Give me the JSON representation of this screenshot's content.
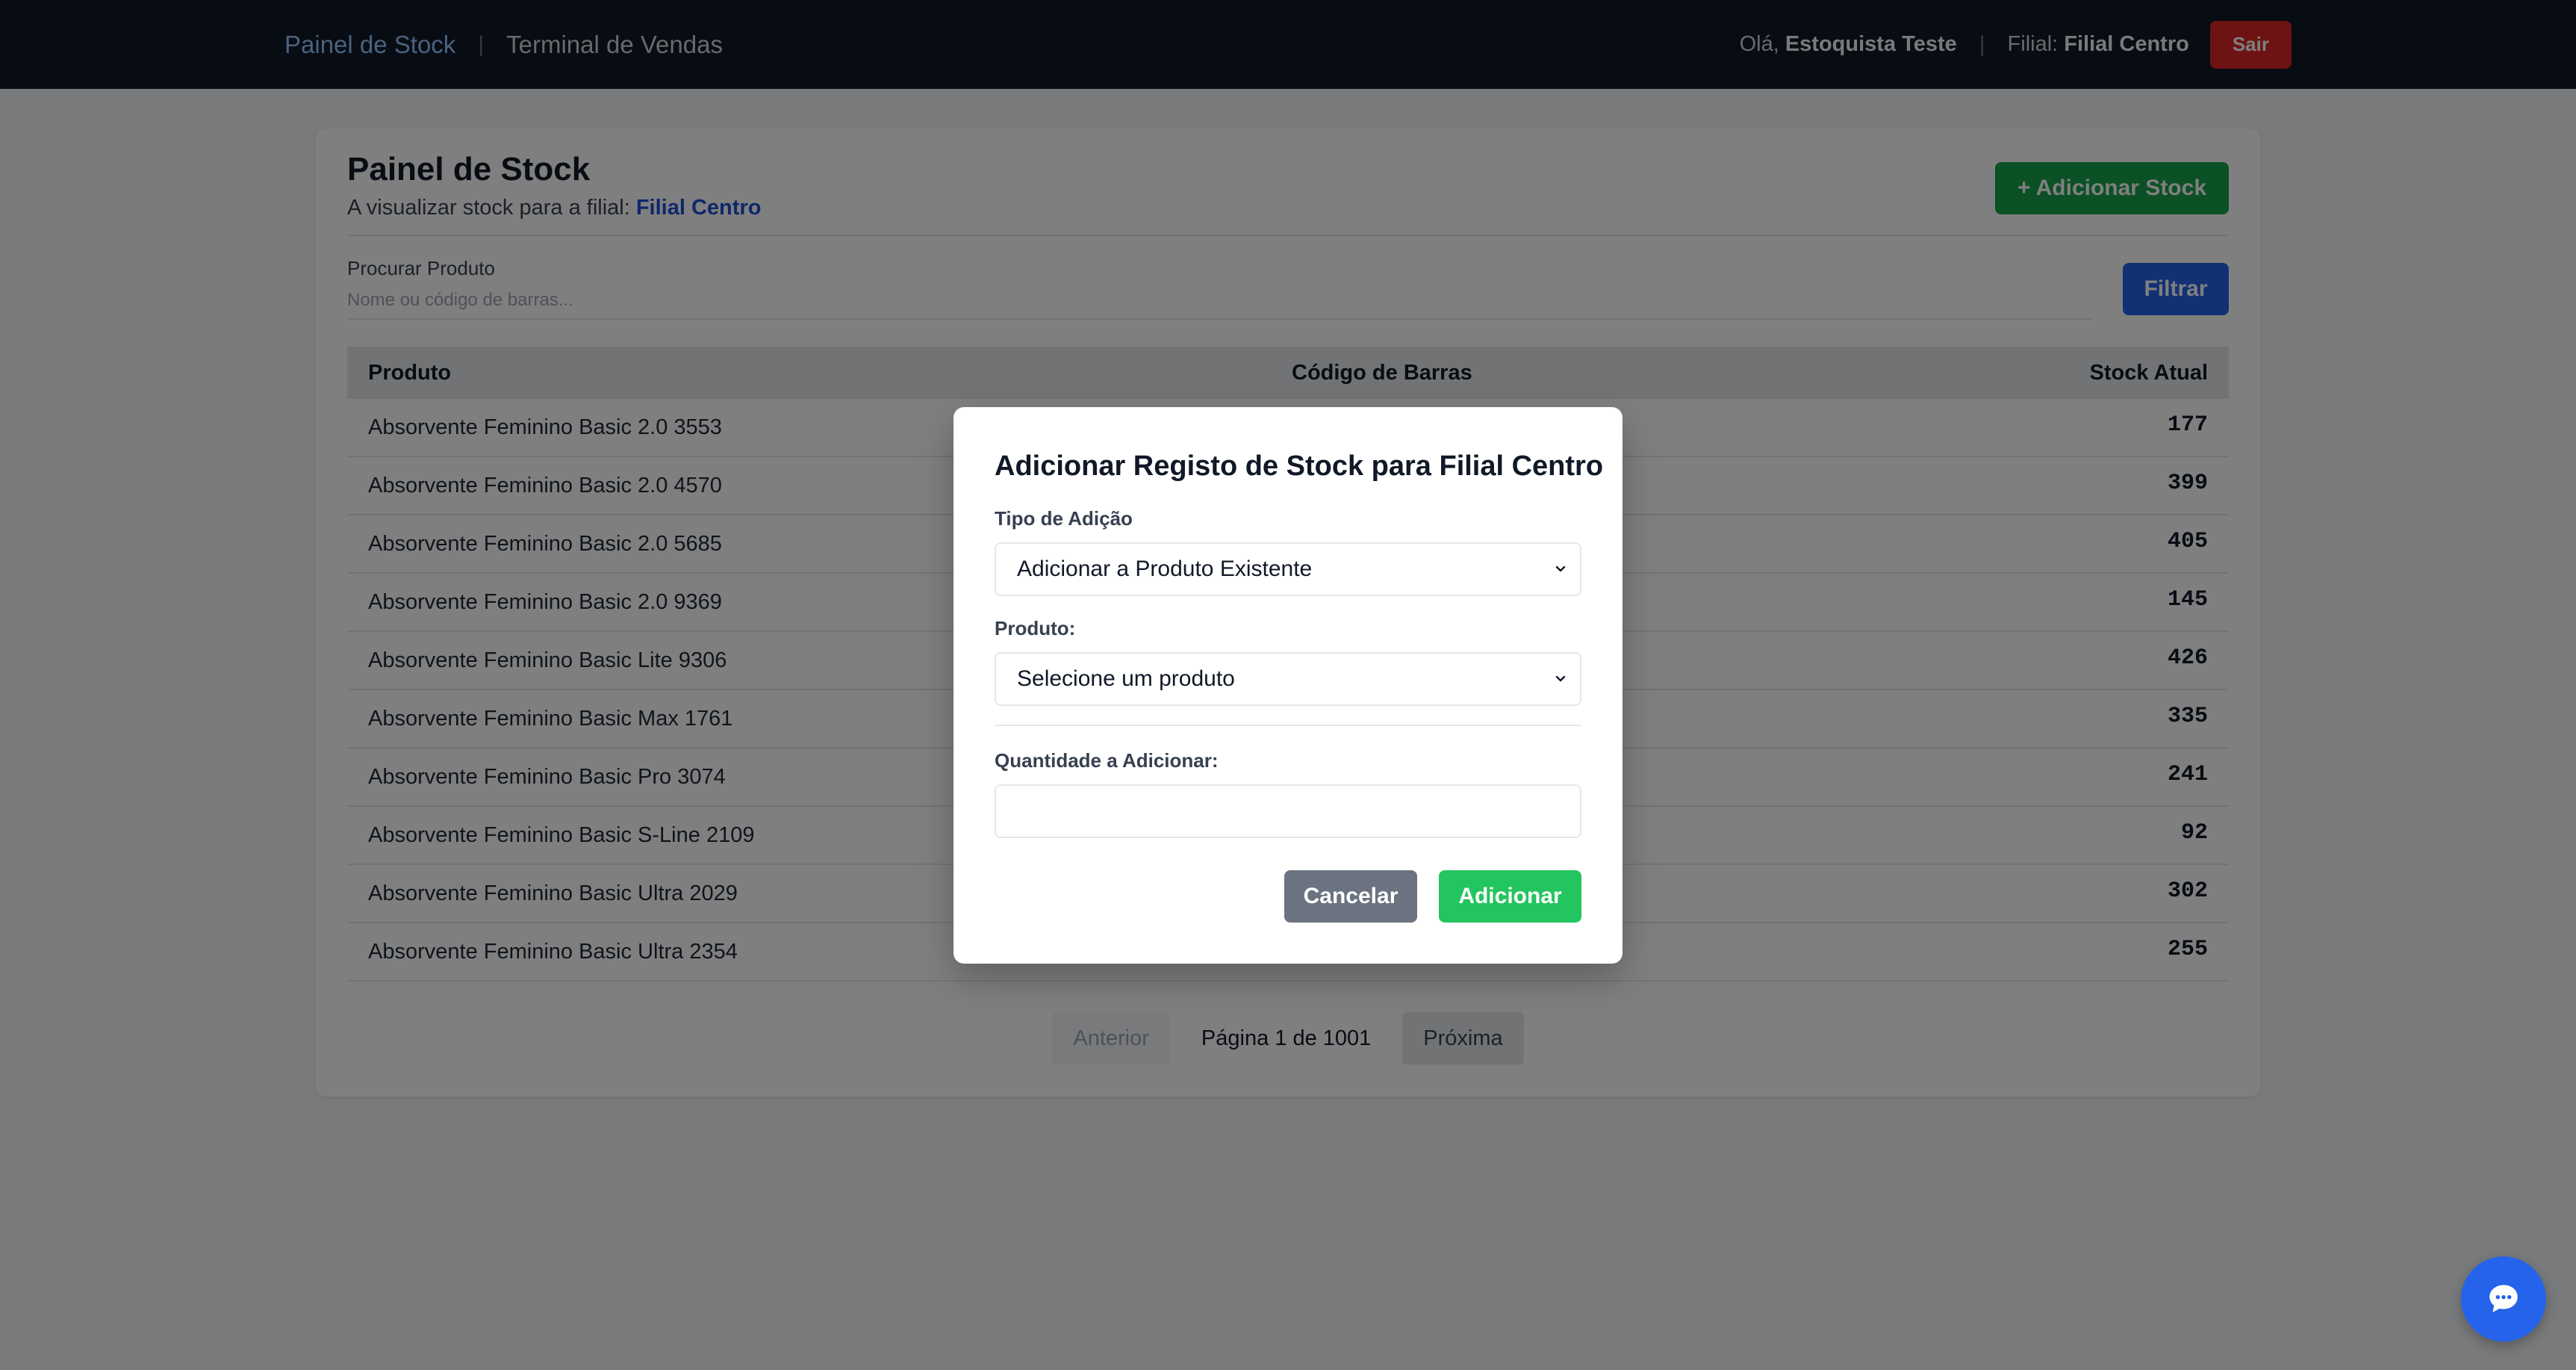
{
  "nav": {
    "stock_panel": "Painel de Stock",
    "sales_terminal": "Terminal de Vendas",
    "greeting_prefix": "Olá,",
    "user_name": "Estoquista Teste",
    "branch_prefix": "Filial:",
    "branch_name": "Filial Centro",
    "logout": "Sair"
  },
  "page": {
    "title": "Painel de Stock",
    "subtitle_prefix": "A visualizar stock para a filial:",
    "subtitle_branch": "Filial Centro",
    "add_stock_button": "+ Adicionar Stock"
  },
  "search": {
    "label": "Procurar Produto",
    "placeholder": "Nome ou código de barras...",
    "filter_button": "Filtrar"
  },
  "table": {
    "headers": [
      "Produto",
      "Código de Barras",
      "Stock Atual"
    ],
    "rows": [
      {
        "product": "Absorvente Feminino Basic 2.0 3553",
        "stock": "177"
      },
      {
        "product": "Absorvente Feminino Basic 2.0 4570",
        "stock": "399"
      },
      {
        "product": "Absorvente Feminino Basic 2.0 5685",
        "stock": "405"
      },
      {
        "product": "Absorvente Feminino Basic 2.0 9369",
        "stock": "145"
      },
      {
        "product": "Absorvente Feminino Basic Lite 9306",
        "stock": "426"
      },
      {
        "product": "Absorvente Feminino Basic Max 1761",
        "stock": "335"
      },
      {
        "product": "Absorvente Feminino Basic Pro 3074",
        "stock": "241"
      },
      {
        "product": "Absorvente Feminino Basic S-Line 2109",
        "stock": "92"
      },
      {
        "product": "Absorvente Feminino Basic Ultra 2029",
        "stock": "302"
      },
      {
        "product": "Absorvente Feminino Basic Ultra 2354",
        "stock": "255"
      }
    ]
  },
  "pagination": {
    "prev": "Anterior",
    "info": "Página 1 de 1001",
    "next": "Próxima"
  },
  "modal": {
    "title": "Adicionar Registo de Stock para Filial Centro",
    "type_label": "Tipo de Adição",
    "type_value": "Adicionar a Produto Existente",
    "product_label": "Produto:",
    "product_value": "Selecione um produto",
    "quantity_label": "Quantidade a Adicionar:",
    "quantity_value": "",
    "cancel_button": "Cancelar",
    "add_button": "Adicionar"
  },
  "chat": {
    "icon": "chat-bubble-icon"
  },
  "colors": {
    "nav_bg": "#111827",
    "primary": "#2563eb",
    "success": "#16a34a",
    "danger": "#dc2626"
  }
}
